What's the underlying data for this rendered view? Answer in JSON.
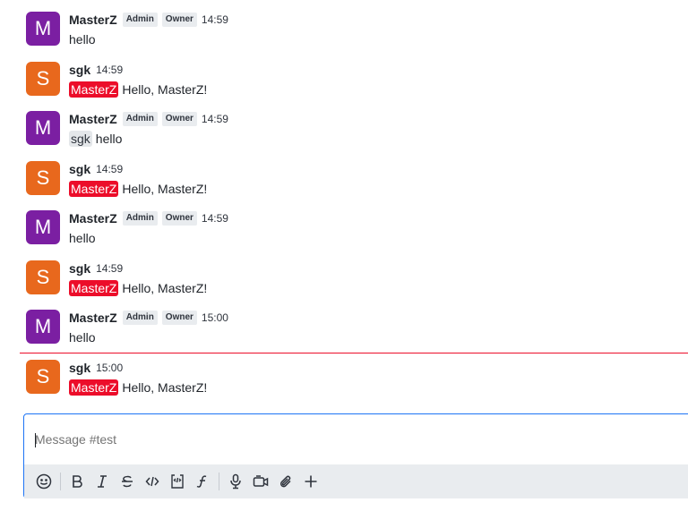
{
  "messages": [
    {
      "avatar": "M",
      "author": "MasterZ",
      "roles": [
        "Admin",
        "Owner"
      ],
      "time": "14:59",
      "mention": "",
      "text": "hello"
    },
    {
      "avatar": "S",
      "author": "sgk",
      "roles": [],
      "time": "14:59",
      "mention": "MasterZ",
      "text": "Hello, MasterZ!"
    },
    {
      "avatar": "M",
      "author": "MasterZ",
      "roles": [
        "Admin",
        "Owner"
      ],
      "time": "14:59",
      "mention": "sgk",
      "text": "hello"
    },
    {
      "avatar": "S",
      "author": "sgk",
      "roles": [],
      "time": "14:59",
      "mention": "MasterZ",
      "text": "Hello, MasterZ!"
    },
    {
      "avatar": "M",
      "author": "MasterZ",
      "roles": [
        "Admin",
        "Owner"
      ],
      "time": "14:59",
      "mention": "",
      "text": "hello"
    },
    {
      "avatar": "S",
      "author": "sgk",
      "roles": [],
      "time": "14:59",
      "mention": "MasterZ",
      "text": "Hello, MasterZ!"
    },
    {
      "avatar": "M",
      "author": "MasterZ",
      "roles": [
        "Admin",
        "Owner"
      ],
      "time": "15:00",
      "mention": "",
      "text": "hello"
    },
    {
      "avatar": "S",
      "author": "sgk",
      "roles": [],
      "time": "15:00",
      "mention": "MasterZ",
      "text": "Hello, MasterZ!"
    }
  ],
  "composer": {
    "placeholder": "Message #test",
    "value": ""
  },
  "toolbar": {
    "icons": [
      "emoji-icon",
      "bold-icon",
      "italic-icon",
      "strikethrough-icon",
      "code-icon",
      "code-block-icon",
      "formula-icon",
      "microphone-icon",
      "video-icon",
      "attachment-icon",
      "plus-icon"
    ]
  },
  "colors": {
    "accent": "#1d74f5",
    "mention_self": "#ec0d2a",
    "avatar_m": "#7b1fa2",
    "avatar_s": "#e8681d"
  }
}
